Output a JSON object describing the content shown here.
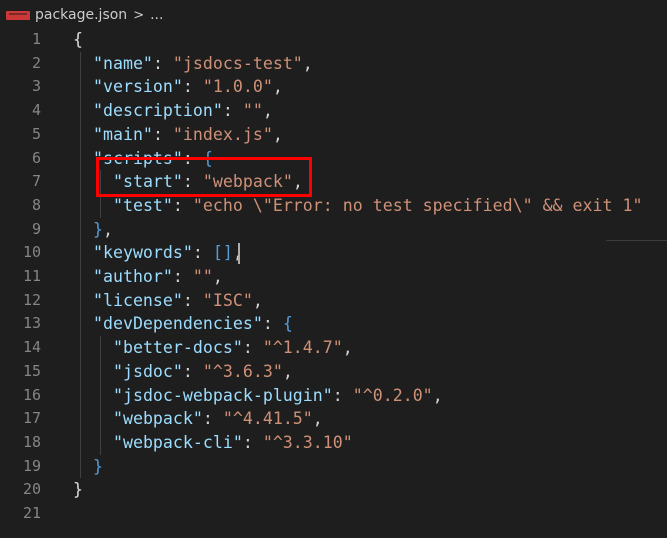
{
  "breadcrumb": {
    "file_icon": "npm-icon",
    "file_name": "package.json",
    "separator": ">",
    "more": "..."
  },
  "colors": {
    "background": "#1e1e1e",
    "key": "#9cdcfe",
    "string": "#ce9178",
    "punctuation": "#d4d4d4",
    "bracket_blue": "#569cd6",
    "line_number": "#858585",
    "highlight_box": "#ff0000"
  },
  "editor": {
    "lines": [
      [
        {
          "t": "{",
          "c": "g"
        }
      ],
      [
        {
          "t": "  "
        },
        {
          "t": "\"name\"",
          "c": "k"
        },
        {
          "t": ": ",
          "c": "p"
        },
        {
          "t": "\"jsdocs-test\"",
          "c": "s"
        },
        {
          "t": ",",
          "c": "p"
        }
      ],
      [
        {
          "t": "  "
        },
        {
          "t": "\"version\"",
          "c": "k"
        },
        {
          "t": ": ",
          "c": "p"
        },
        {
          "t": "\"1.0.0\"",
          "c": "s"
        },
        {
          "t": ",",
          "c": "p"
        }
      ],
      [
        {
          "t": "  "
        },
        {
          "t": "\"description\"",
          "c": "k"
        },
        {
          "t": ": ",
          "c": "p"
        },
        {
          "t": "\"\"",
          "c": "s"
        },
        {
          "t": ",",
          "c": "p"
        }
      ],
      [
        {
          "t": "  "
        },
        {
          "t": "\"main\"",
          "c": "k"
        },
        {
          "t": ": ",
          "c": "p"
        },
        {
          "t": "\"index.js\"",
          "c": "s"
        },
        {
          "t": ",",
          "c": "p"
        }
      ],
      [
        {
          "t": "  "
        },
        {
          "t": "\"scripts\"",
          "c": "k"
        },
        {
          "t": ": ",
          "c": "p"
        },
        {
          "t": "{",
          "c": "b"
        }
      ],
      [
        {
          "t": "    "
        },
        {
          "t": "\"start\"",
          "c": "k"
        },
        {
          "t": ": ",
          "c": "p"
        },
        {
          "t": "\"webpack\"",
          "c": "s"
        },
        {
          "t": ",",
          "c": "p"
        }
      ],
      [
        {
          "t": "    "
        },
        {
          "t": "\"test\"",
          "c": "k"
        },
        {
          "t": ": ",
          "c": "p"
        },
        {
          "t": "\"echo \\\"Error: no test specified\\\" && exit 1\"",
          "c": "s"
        }
      ],
      [
        {
          "t": "  "
        },
        {
          "t": "}",
          "c": "b"
        },
        {
          "t": ",",
          "c": "p"
        }
      ],
      [
        {
          "t": "  "
        },
        {
          "t": "\"keywords\"",
          "c": "k"
        },
        {
          "t": ": ",
          "c": "p"
        },
        {
          "t": "[]",
          "c": "b"
        },
        {
          "t": ",",
          "c": "p"
        }
      ],
      [
        {
          "t": "  "
        },
        {
          "t": "\"author\"",
          "c": "k"
        },
        {
          "t": ": ",
          "c": "p"
        },
        {
          "t": "\"\"",
          "c": "s"
        },
        {
          "t": ",",
          "c": "p"
        }
      ],
      [
        {
          "t": "  "
        },
        {
          "t": "\"license\"",
          "c": "k"
        },
        {
          "t": ": ",
          "c": "p"
        },
        {
          "t": "\"ISC\"",
          "c": "s"
        },
        {
          "t": ",",
          "c": "p"
        }
      ],
      [
        {
          "t": "  "
        },
        {
          "t": "\"devDependencies\"",
          "c": "k"
        },
        {
          "t": ": ",
          "c": "p"
        },
        {
          "t": "{",
          "c": "b"
        }
      ],
      [
        {
          "t": "    "
        },
        {
          "t": "\"better-docs\"",
          "c": "k"
        },
        {
          "t": ": ",
          "c": "p"
        },
        {
          "t": "\"^1.4.7\"",
          "c": "s"
        },
        {
          "t": ",",
          "c": "p"
        }
      ],
      [
        {
          "t": "    "
        },
        {
          "t": "\"jsdoc\"",
          "c": "k"
        },
        {
          "t": ": ",
          "c": "p"
        },
        {
          "t": "\"^3.6.3\"",
          "c": "s"
        },
        {
          "t": ",",
          "c": "p"
        }
      ],
      [
        {
          "t": "    "
        },
        {
          "t": "\"jsdoc-webpack-plugin\"",
          "c": "k"
        },
        {
          "t": ": ",
          "c": "p"
        },
        {
          "t": "\"^0.2.0\"",
          "c": "s"
        },
        {
          "t": ",",
          "c": "p"
        }
      ],
      [
        {
          "t": "    "
        },
        {
          "t": "\"webpack\"",
          "c": "k"
        },
        {
          "t": ": ",
          "c": "p"
        },
        {
          "t": "\"^4.41.5\"",
          "c": "s"
        },
        {
          "t": ",",
          "c": "p"
        }
      ],
      [
        {
          "t": "    "
        },
        {
          "t": "\"webpack-cli\"",
          "c": "k"
        },
        {
          "t": ": ",
          "c": "p"
        },
        {
          "t": "\"^3.3.10\"",
          "c": "s"
        }
      ],
      [
        {
          "t": "  "
        },
        {
          "t": "}",
          "c": "b"
        }
      ],
      [
        {
          "t": "}",
          "c": "g"
        }
      ],
      []
    ]
  }
}
